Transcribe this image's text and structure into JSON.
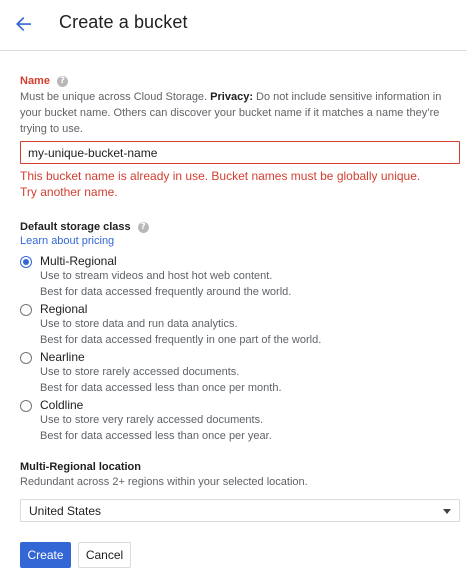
{
  "header": {
    "title": "Create a bucket",
    "back_icon": "arrow-left-icon"
  },
  "name_section": {
    "label": "Name",
    "help_icon": "help-icon",
    "description_part1": "Must be unique across Cloud Storage. ",
    "description_bold": "Privacy:",
    "description_part2": " Do not include sensitive information in your bucket name. Others can discover your bucket name if it matches a name they’re trying to use.",
    "input_value": "my-unique-bucket-name",
    "error": "This bucket name is already in use. Bucket names must be globally unique. Try another name."
  },
  "storage_class": {
    "label": "Default storage class",
    "help_icon": "help-icon",
    "pricing_link": "Learn about pricing",
    "selected": "Multi-Regional",
    "options": [
      {
        "label": "Multi-Regional",
        "desc1": "Use to stream videos and host hot web content.",
        "desc2": "Best for data accessed frequently around the world."
      },
      {
        "label": "Regional",
        "desc1": "Use to store data and run data analytics.",
        "desc2": "Best for data accessed frequently in one part of the world."
      },
      {
        "label": "Nearline",
        "desc1": "Use to store rarely accessed documents.",
        "desc2": "Best for data accessed less than once per month."
      },
      {
        "label": "Coldline",
        "desc1": "Use to store very rarely accessed documents.",
        "desc2": "Best for data accessed less than once per year."
      }
    ]
  },
  "location": {
    "label": "Multi-Regional location",
    "description": "Redundant across 2+ regions within your selected location.",
    "selected_value": "United States"
  },
  "actions": {
    "create_label": "Create",
    "cancel_label": "Cancel"
  },
  "colors": {
    "accent": "#3367d6",
    "error": "#d23f31"
  }
}
